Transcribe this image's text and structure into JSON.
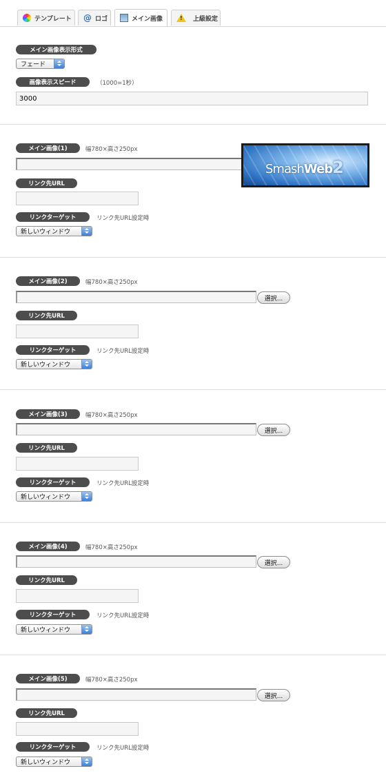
{
  "tabs": [
    {
      "label": "テンプレート",
      "icon": "color-wheel-icon"
    },
    {
      "label": "ロゴ",
      "icon": "at-icon"
    },
    {
      "label": "メイン画像",
      "icon": "image-icon",
      "active": true
    },
    {
      "label": "上級設定",
      "icon": "warning-icon"
    }
  ],
  "display": {
    "format_label": "メイン画像表示形式",
    "format_value": "フェード",
    "speed_label": "画像表示スピード",
    "speed_note": "（1000=1秒）",
    "speed_value": "3000"
  },
  "images": [
    {
      "label": "メイン画像(1)",
      "size_note": "幅780×高さ250px",
      "url_label": "リンク先URL",
      "url_value": "",
      "target_label": "リンクターゲット",
      "target_note": "リンク先URL設定時",
      "target_value": "新しいウィンドウ",
      "has_preview": true
    },
    {
      "label": "メイン画像(2)",
      "size_note": "幅780×高さ250px",
      "select_button": "選択...",
      "url_label": "リンク先URL",
      "url_value": "",
      "target_label": "リンクターゲット",
      "target_note": "リンク先URL設定時",
      "target_value": "新しいウィンドウ"
    },
    {
      "label": "メイン画像(3)",
      "size_note": "幅780×高さ250px",
      "select_button": "選択...",
      "url_label": "リンク先URL",
      "url_value": "",
      "target_label": "リンクターゲット",
      "target_note": "リンク先URL設定時",
      "target_value": "新しいウィンドウ"
    },
    {
      "label": "メイン画像(4)",
      "size_note": "幅780×高さ250px",
      "select_button": "選択...",
      "url_label": "リンク先URL",
      "url_value": "",
      "target_label": "リンクターゲット",
      "target_note": "リンク先URL設定時",
      "target_value": "新しいウィンドウ"
    },
    {
      "label": "メイン画像(5)",
      "size_note": "幅780×高さ250px",
      "select_button": "選択...",
      "url_label": "リンク先URL",
      "url_value": "",
      "target_label": "リンクターゲット",
      "target_note": "リンク先URL設定時",
      "target_value": "新しいウィンドウ"
    }
  ],
  "preview": {
    "logo_text_a": "Smash",
    "logo_text_b": "Web",
    "logo_text_c": "2"
  },
  "colors": {
    "label_pill": "#4d4d4d",
    "select_arrow": "#3f7fd6",
    "divider": "#dcdcdc"
  }
}
